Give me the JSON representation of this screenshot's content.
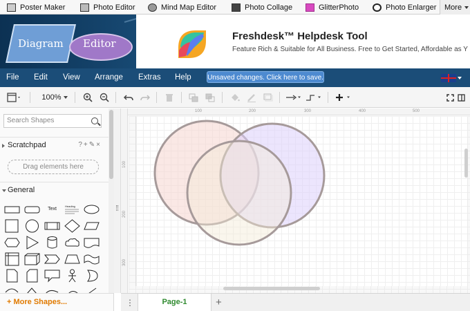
{
  "top_tabs": [
    {
      "label": "Poster Maker",
      "icon": "poster-icon"
    },
    {
      "label": "Photo Editor",
      "icon": "photo-editor-icon"
    },
    {
      "label": "Mind Map Editor",
      "icon": "mind-map-icon"
    },
    {
      "label": "Photo Collage",
      "icon": "collage-icon"
    },
    {
      "label": "GlitterPhoto",
      "icon": "glitter-icon"
    },
    {
      "label": "Photo Enlarger",
      "icon": "magnifier-icon"
    },
    {
      "label": "More",
      "icon": "chevron-down-icon"
    }
  ],
  "logo": {
    "word1": "Diagram",
    "word2": "Editor"
  },
  "ad": {
    "title": "Freshdesk™ Helpdesk Tool",
    "subtitle": "Feature Rich & Suitable for All Business. Free to Get Started, Affordable as Y"
  },
  "menu": [
    "File",
    "Edit",
    "View",
    "Arrange",
    "Extras",
    "Help"
  ],
  "unsaved_label": "Unsaved changes. Click here to save.",
  "toolbar": {
    "zoom": "100%"
  },
  "sidebar": {
    "search_placeholder": "Search Shapes",
    "scratchpad_label": "Scratchpad",
    "scratchpad_actions": "?+✎×",
    "drag_hint": "Drag elements here",
    "general_label": "General",
    "shape_text_label": "Text",
    "shape_heading_label": "Heading",
    "more_shapes": "+ More Shapes..."
  },
  "rulers": {
    "top": [
      "100",
      "200",
      "300",
      "400",
      "500"
    ],
    "left": [
      "100",
      "200",
      "300"
    ]
  },
  "venn": [
    {
      "fill": "#f6d6d0"
    },
    {
      "fill": "#dcd0fb"
    },
    {
      "fill": "#f3ecd6"
    }
  ],
  "pages": {
    "current": "Page-1"
  },
  "colors": {
    "menubar": "#1b4d78",
    "accent": "#4d8ad0",
    "page_tab": "#2f8a2f"
  }
}
